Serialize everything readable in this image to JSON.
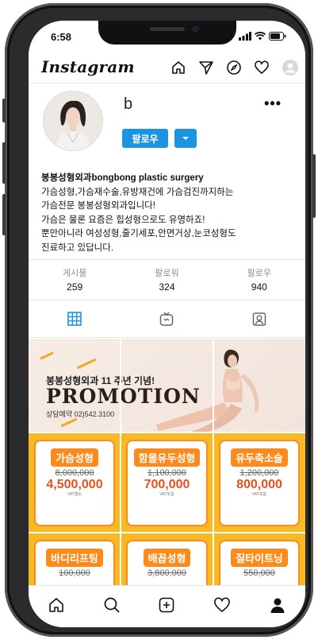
{
  "status": {
    "time": "6:58"
  },
  "app": {
    "logo": "Instagram"
  },
  "profile": {
    "username": "b",
    "more": "•••",
    "follow_label": "팔로우",
    "bio": {
      "name": "봉봉성형외과bongbong plastic surgery",
      "lines": [
        "가슴성형,가슴재수술,유방재건에 가슴검진까지하는",
        "가슴전문 봉봉성형외과입니다!",
        "가슴은 물론 요즘은 힙성형으로도 유명하죠!",
        "뿐만아니라 여성성형,줄기세포,안면거상,눈코성형도",
        "진료하고 있답니다."
      ]
    },
    "stats": [
      {
        "label": "게시물",
        "value": "259"
      },
      {
        "label": "팔로워",
        "value": "324"
      },
      {
        "label": "팔로우",
        "value": "940"
      }
    ]
  },
  "post": {
    "headline": "봉봉성형외과 11 주년 기념!",
    "promo": "PROMOTION",
    "contact": "상담예약 02)542.3100",
    "cards": [
      {
        "title": "가슴성형",
        "old": "8,000,000",
        "new": "4,500,000",
        "vat": "VAT별도"
      },
      {
        "title": "함몰유두성형",
        "old": "1,100,000",
        "new": "700,000",
        "vat": "VAT포함"
      },
      {
        "title": "유두축소술",
        "old": "1,200,000",
        "new": "800,000",
        "vat": "VAT포함"
      },
      {
        "title": "바디리프팅",
        "old": "100,000",
        "new": "",
        "vat": ""
      },
      {
        "title": "배꼽성형",
        "old": "3,800,000",
        "new": "",
        "vat": ""
      },
      {
        "title": "질타이트닝",
        "old": "550,000",
        "new": "",
        "vat": ""
      }
    ]
  },
  "colors": {
    "accent": "#1b95e0",
    "orange": "#ff8a1c",
    "yellow": "#f7b924"
  }
}
